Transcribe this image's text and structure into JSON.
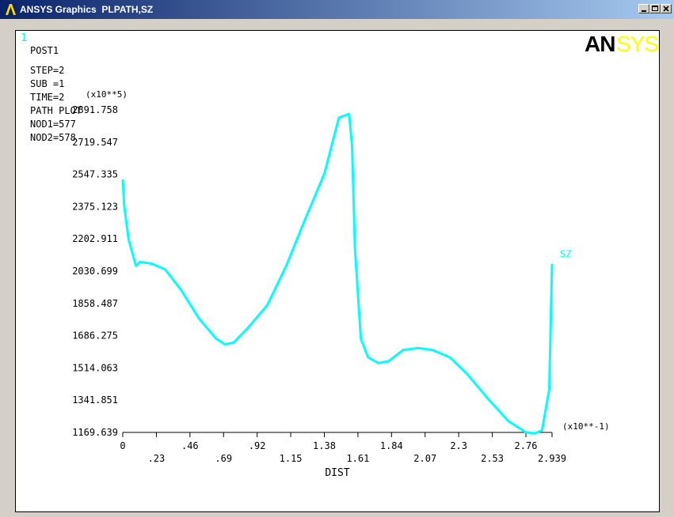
{
  "window": {
    "title": "ANSYS Graphics  PLPATH,SZ"
  },
  "icons": {
    "app": "ansys-logo-icon",
    "minimize": "minimize-icon",
    "maximize": "maximize-icon",
    "close": "close-icon"
  },
  "plot": {
    "window_number": "1",
    "logo_an": "AN",
    "logo_sys": "SYS",
    "info": [
      "POST1",
      "STEP=2",
      "SUB =1",
      "TIME=2",
      "PATH PLOT",
      "NOD1=577",
      "NOD2=578"
    ],
    "y_multiplier": "(x10**5)",
    "x_multiplier": "(x10**-1)"
  },
  "colors": {
    "curve": "#00ffff",
    "logo_black": "#000000",
    "logo_yellow": "#ffff00",
    "window_number": "#00ffff"
  },
  "chart_data": {
    "type": "line",
    "title": "",
    "xlabel": "DIST",
    "ylabel": "",
    "xlim": [
      0,
      2.939
    ],
    "ylim": [
      1169.639,
      2891.758
    ],
    "x_ticks_top": [
      "0",
      ".46",
      ".92",
      "1.38",
      "1.84",
      "2.3",
      "2.76"
    ],
    "x_ticks_bottom": [
      ".23",
      ".69",
      "1.15",
      "1.61",
      "2.07",
      "2.53",
      "2.939"
    ],
    "x_tick_values_top": [
      0,
      0.46,
      0.92,
      1.38,
      1.84,
      2.3,
      2.76
    ],
    "x_tick_values_bottom": [
      0.23,
      0.69,
      1.15,
      1.61,
      2.07,
      2.53,
      2.939
    ],
    "y_ticks": [
      "1169.639",
      "1341.851",
      "1514.063",
      "1686.275",
      "1858.487",
      "2030.699",
      "2202.911",
      "2375.123",
      "2547.335",
      "2719.547",
      "2891.758"
    ],
    "y_tick_values": [
      1169.639,
      1341.851,
      1514.063,
      1686.275,
      1858.487,
      2030.699,
      2202.911,
      2375.123,
      2547.335,
      2719.547,
      2891.758
    ],
    "series": [
      {
        "name": "SZ",
        "x": [
          0,
          0.01,
          0.04,
          0.09,
          0.12,
          0.2,
          0.29,
          0.4,
          0.52,
          0.64,
          0.7,
          0.76,
          0.86,
          0.99,
          1.12,
          1.25,
          1.38,
          1.48,
          1.55,
          1.57,
          1.59,
          1.63,
          1.68,
          1.75,
          1.82,
          1.92,
          2.02,
          2.12,
          2.24,
          2.36,
          2.5,
          2.64,
          2.76,
          2.82,
          2.87,
          2.92,
          2.939
        ],
        "y": [
          2520,
          2380,
          2200,
          2060,
          2080,
          2070,
          2040,
          1930,
          1780,
          1670,
          1640,
          1650,
          1730,
          1850,
          2060,
          2310,
          2550,
          2850,
          2870,
          2700,
          2150,
          1670,
          1570,
          1540,
          1550,
          1610,
          1620,
          1610,
          1570,
          1480,
          1350,
          1230,
          1170,
          1165,
          1180,
          1400,
          2070
        ]
      }
    ]
  }
}
